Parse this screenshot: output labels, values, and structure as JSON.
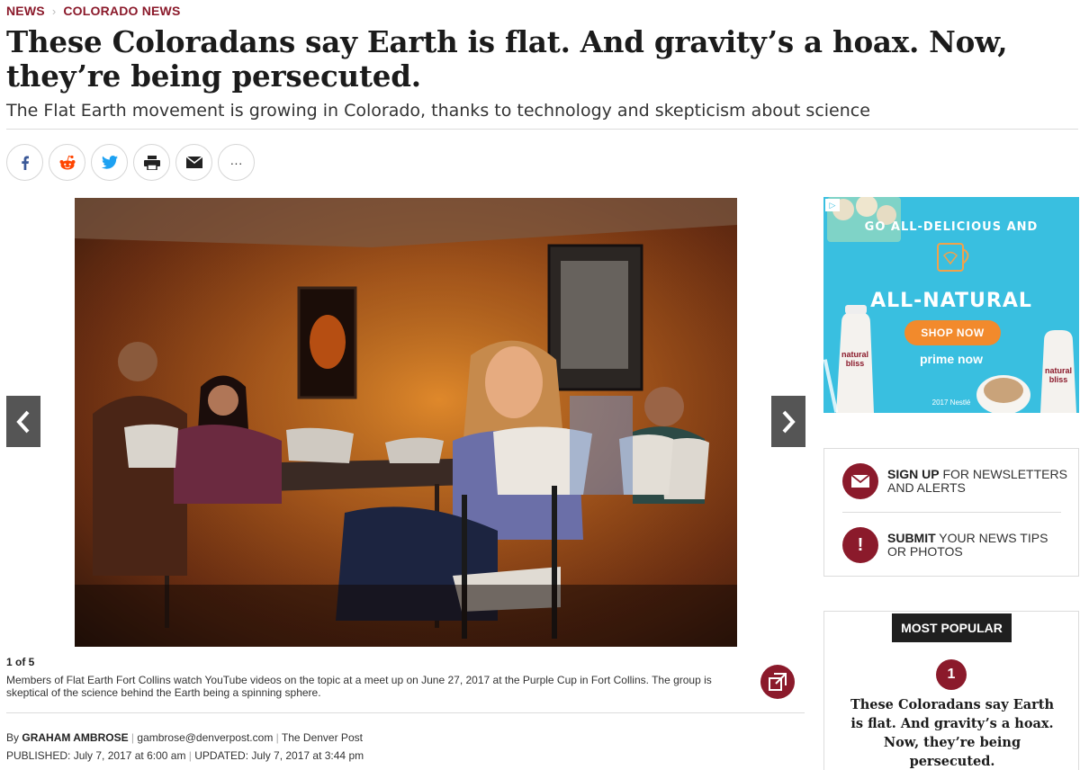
{
  "breadcrumb": {
    "section": "NEWS",
    "subsection": "COLORADO NEWS"
  },
  "article": {
    "headline": "These Coloradans say Earth is flat. And gravity’s a hoax. Now, they’re being persecuted.",
    "subhead": "The Flat Earth movement is growing in Colorado, thanks to technology and skepticism about science",
    "byline_prefix": "By",
    "author": "GRAHAM AMBROSE",
    "email": "gambrose@denverpost.com",
    "outlet": "The Denver Post",
    "published": "PUBLISHED: July 7, 2017 at 6:00 am",
    "updated": "UPDATED: July 7, 2017 at 3:44 pm"
  },
  "share": [
    {
      "name": "facebook-icon"
    },
    {
      "name": "reddit-icon"
    },
    {
      "name": "twitter-icon"
    },
    {
      "name": "print-icon"
    },
    {
      "name": "email-icon"
    },
    {
      "name": "more-icon",
      "glyph": "···"
    }
  ],
  "gallery": {
    "counter": "1 of 5",
    "caption": "Members of Flat Earth Fort Collins watch YouTube videos on the topic at a meet up on June 27, 2017 at the Purple Cup in Fort Collins. The group is skeptical of the science behind the Earth being a spinning sphere."
  },
  "ad": {
    "tagline": "GO ALL-DELICIOUS AND",
    "headline": "ALL-NATURAL",
    "cta": "SHOP NOW",
    "partner": "prime now",
    "legal": "2017 Nestlé",
    "bottle_label_1": "natural bliss",
    "bottle_label_2": "natural bliss",
    "bg_color": "#39bfe0",
    "cta_color": "#f28a2c"
  },
  "promo": {
    "signup_bold": "SIGN UP",
    "signup_rest": " FOR NEWSLETTERS AND ALERTS",
    "submit_bold": "SUBMIT",
    "submit_rest": " YOUR NEWS TIPS OR PHOTOS"
  },
  "popular": {
    "label": "MOST POPULAR",
    "rank": "1",
    "title": "These Coloradans say Earth is flat. And gravity’s a hoax. Now, they’re being persecuted."
  },
  "colors": {
    "brand": "#8b1a2b",
    "nav_button": "#555555"
  }
}
